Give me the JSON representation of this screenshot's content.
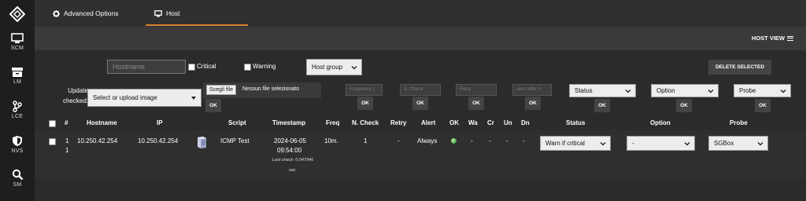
{
  "sidebar": {
    "items": [
      {
        "label": "SCM",
        "icon": "monitor-icon"
      },
      {
        "label": "LM",
        "icon": "archive-icon"
      },
      {
        "label": "LCE",
        "icon": "branch-icon"
      },
      {
        "label": "NVS",
        "icon": "shield-icon"
      },
      {
        "label": "SM",
        "icon": "search-icon"
      }
    ]
  },
  "tabs": [
    {
      "label": "Advanced Options",
      "icon": "gear-icon"
    },
    {
      "label": "Host",
      "icon": "monitor-icon",
      "active": true
    }
  ],
  "panel": {
    "host_view_label": "HOST VIEW"
  },
  "filters": {
    "hostname_placeholder": "Hostname",
    "critical_label": "Critical",
    "warning_label": "Warning",
    "host_group_value": "Host group",
    "delete_selected_label": "DELETE SELECTED",
    "update_checked_label_1": "Update",
    "update_checked_label_2": "checked:",
    "image_select_value": "Select or upload image",
    "file_button_label": "Scegli file",
    "file_status": "Nessun file selezionato",
    "frequency_placeholder": "Frequency (",
    "ncheck_placeholder": "N. Check",
    "retry_placeholder": "Retry",
    "alert_after_placeholder": "Alert after h",
    "status_value": "Status",
    "option_value": "Option",
    "probe_value": "Probe",
    "ok_label": "OK"
  },
  "table": {
    "headers": [
      "#",
      "Hostname",
      "IP",
      "Script",
      "Timestamp",
      "Freq",
      "N. Check",
      "Retry",
      "Alert",
      "OK",
      "Wa",
      "Cr",
      "Un",
      "Dn",
      "Status",
      "Option",
      "Probe"
    ],
    "row": {
      "num_line1": "1",
      "num_line2": "1",
      "hostname": "10.250.42.254",
      "ip": "10.250.42.254",
      "script": "ICMP Test",
      "timestamp_date": "2024-06-05",
      "timestamp_time": "09:54:00",
      "last_check_1": "Last check: 0.047946",
      "last_check_2": "sec.",
      "freq": "10m.",
      "ncheck": "1",
      "retry": "-",
      "alert": "Always",
      "wa": "-",
      "cr": "-",
      "un": "-",
      "dn": "-",
      "status_value": "Warn if critical",
      "option_value": "-",
      "probe_value": "SGBox",
      "ok_color": "#4caf50"
    }
  },
  "colors": {
    "accent": "#d9822b"
  }
}
